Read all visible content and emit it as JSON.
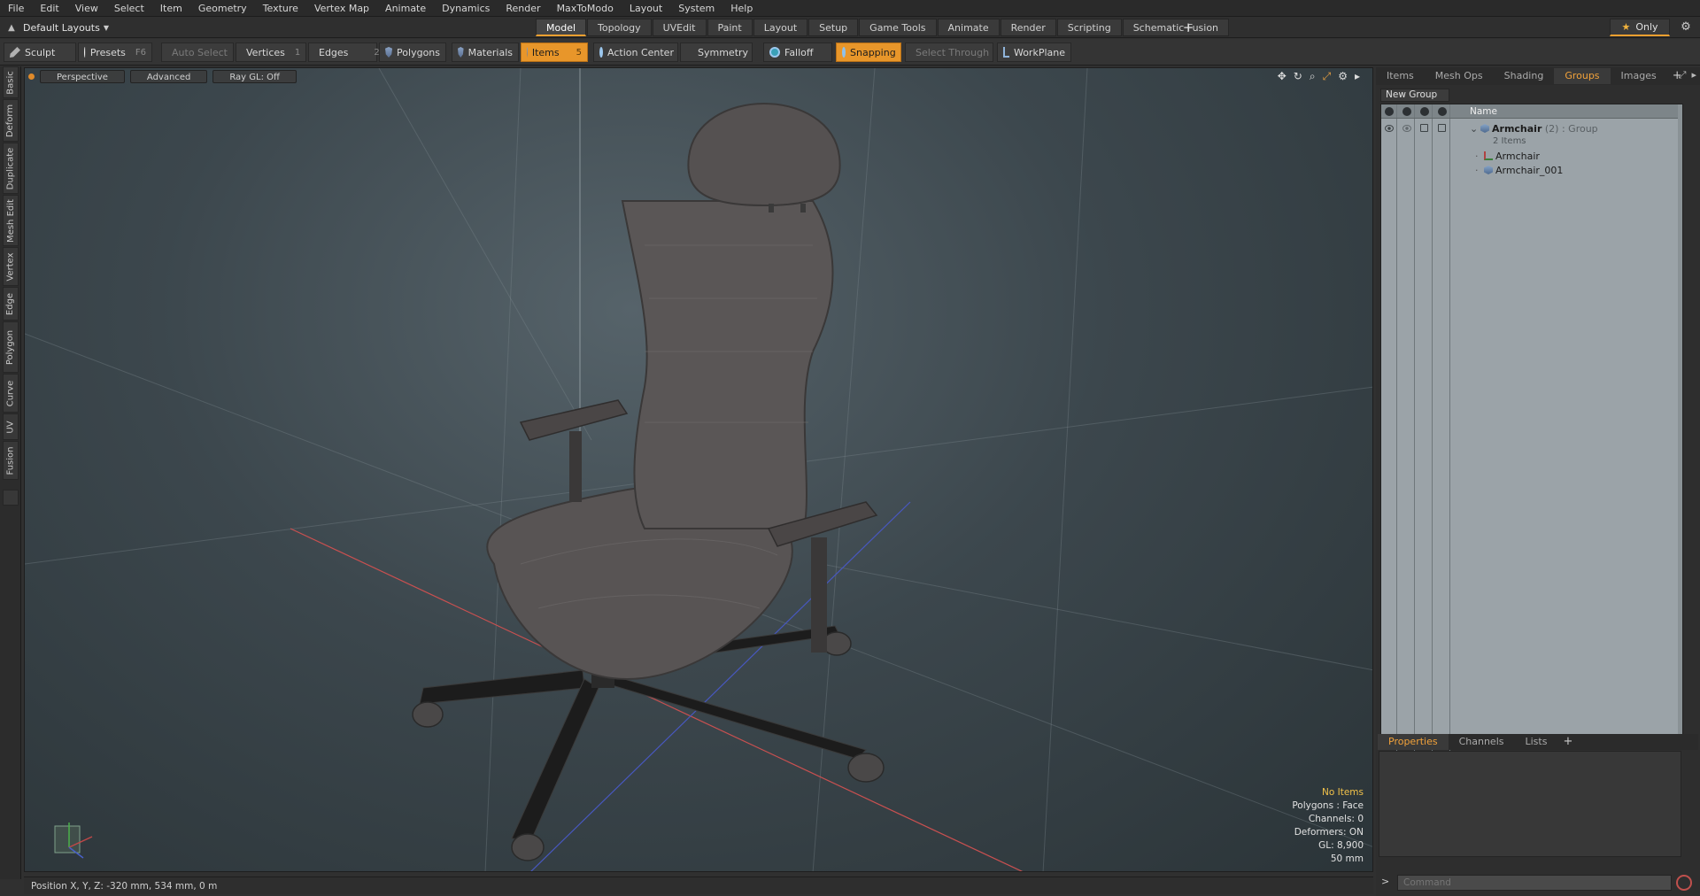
{
  "menu": [
    "File",
    "Edit",
    "View",
    "Select",
    "Item",
    "Geometry",
    "Texture",
    "Vertex Map",
    "Animate",
    "Dynamics",
    "Render",
    "MaxToModo",
    "Layout",
    "System",
    "Help"
  ],
  "layout_selector": "Default Layouts",
  "mode_tabs": [
    "Model",
    "Topology",
    "UVEdit",
    "Paint",
    "Layout",
    "Setup",
    "Game Tools",
    "Animate",
    "Render",
    "Scripting",
    "Schematic Fusion"
  ],
  "mode_tab_active": "Model",
  "only_label": "Only",
  "toolbar": {
    "sculpt": "Sculpt",
    "presets": "Presets",
    "presets_key": "F6",
    "auto_select": "Auto Select",
    "vertices": "Vertices",
    "vertices_key": "1",
    "edges": "Edges",
    "edges_key": "2",
    "polygons": "Polygons",
    "materials": "Materials",
    "items": "Items",
    "items_key": "5",
    "action_center": "Action Center",
    "symmetry": "Symmetry",
    "falloff": "Falloff",
    "snapping": "Snapping",
    "select_through": "Select Through",
    "workplane": "WorkPlane"
  },
  "left_tabs": [
    "Basic",
    "Deform",
    "Duplicate",
    "Mesh Edit",
    "Vertex",
    "Edge",
    "Polygon",
    "Curve",
    "UV",
    "Fusion"
  ],
  "viewport": {
    "view_label": "Perspective",
    "shading_label": "Advanced",
    "raygl_label": "Ray GL: Off",
    "info": {
      "selection": "No Items",
      "polygons": "Polygons : Face",
      "channels": "Channels: 0",
      "deformers": "Deformers: ON",
      "gl": "GL: 8,900",
      "grid": "50 mm"
    }
  },
  "status_bar": "Position X, Y, Z:  -320 mm, 534 mm, 0 m",
  "right_panel": {
    "tabs": [
      "Items",
      "Mesh Ops",
      "Shading",
      "Groups",
      "Images"
    ],
    "active_tab": "Groups",
    "new_group_label": "New Group",
    "name_column": "Name",
    "group": {
      "name": "Armchair",
      "count": "(2)",
      "type": ": Group",
      "items_label": "2 Items",
      "children": [
        "Armchair",
        "Armchair_001"
      ]
    },
    "lower_tabs": [
      "Properties",
      "Channels",
      "Lists"
    ],
    "lower_active": "Properties",
    "command_placeholder": "Command"
  },
  "colors": {
    "accent": "#f0a030",
    "viewport_center": "#56636a",
    "viewport_edge": "#2b3438",
    "groups_panel": "#9ba3a8"
  }
}
